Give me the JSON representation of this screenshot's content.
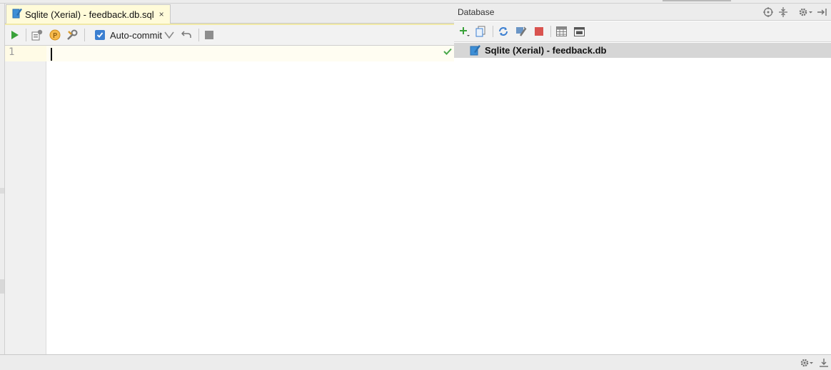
{
  "editor": {
    "tab": {
      "title": "Sqlite (Xerial) - feedback.db.sql",
      "close_glyph": "×",
      "icon": "sql-file-icon"
    },
    "toolbar": {
      "items": [
        "run-icon",
        "explain-plan-icon",
        "parameters-icon",
        "settings-wrench-icon"
      ],
      "auto_commit": {
        "label": "Auto-commit",
        "checked": true
      },
      "undo_icon": "rollback-icon",
      "stop_icon": "stop-icon"
    },
    "line_numbers": [
      "1"
    ],
    "content": "",
    "status_icon": "check-icon"
  },
  "database": {
    "title": "Database",
    "header_icons": [
      "target-icon",
      "collapse-icon",
      "gear-icon",
      "hide-icon"
    ],
    "toolbar": [
      "add-icon",
      "copy-icon",
      "refresh-icon",
      "properties-icon",
      "stop-icon",
      "table-icon",
      "console-icon"
    ],
    "tree": [
      {
        "label": "Sqlite (Xerial) - feedback.db",
        "icon": "datasource-icon",
        "selected": true
      }
    ]
  },
  "status_bar": {
    "icons": [
      "gear-icon",
      "pin-icon"
    ]
  },
  "colors": {
    "tab_active": "#fffbd9",
    "run_green": "#3aa23a",
    "checkbox_blue": "#3b7fd1",
    "stop_red": "#d9534f",
    "selection_gray": "#d6d6d6"
  }
}
